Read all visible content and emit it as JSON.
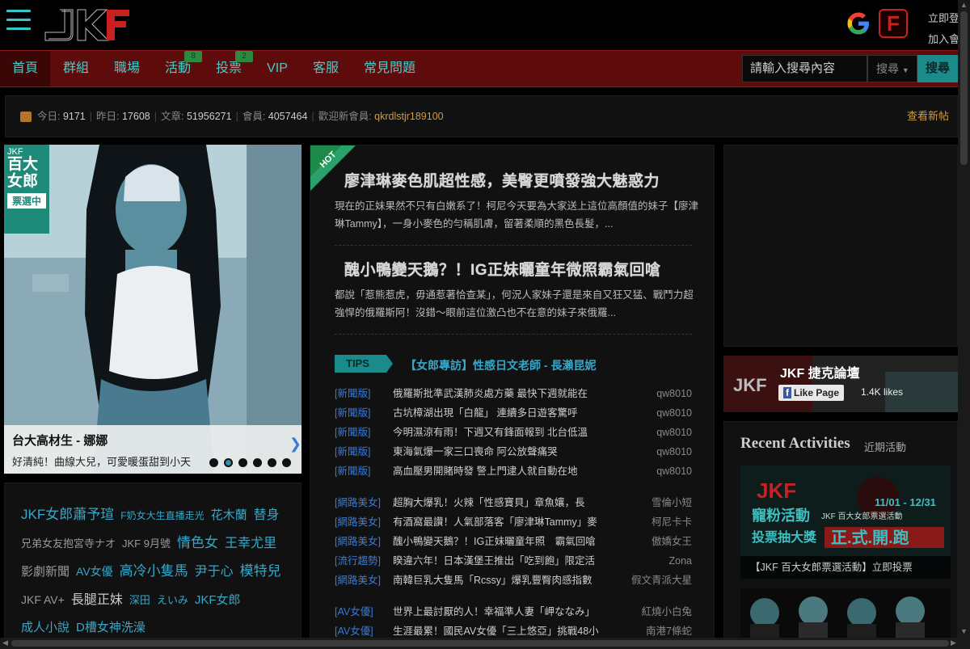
{
  "header": {
    "logo_text": "JKF",
    "right_links": [
      "立即登",
      "加入會"
    ],
    "g_icon": "google-icon",
    "f_icon": "F"
  },
  "nav": {
    "items": [
      "首頁",
      "群組",
      "職場",
      "活動",
      "投票",
      "VIP",
      "客服",
      "常見問題"
    ],
    "badges": [
      "8",
      "2"
    ]
  },
  "search": {
    "placeholder": "請輸入搜尋內容",
    "select_value": "搜尋",
    "button_label": "搜尋"
  },
  "stats": {
    "today_label": "今日: ",
    "today": "9171",
    "yesterday_label": "昨日: ",
    "yesterday": "17608",
    "posts_label": "文章: ",
    "posts": "51956271",
    "members_label": "會員: ",
    "members": "4057464",
    "welcome_label": "歡迎新會員: ",
    "new_member": "qkrdlstjr189100",
    "new_posts": "查看新帖"
  },
  "banner": {
    "badge_lines": [
      "JKF",
      "百大",
      "女郎",
      "票選中"
    ],
    "title": "台大高材生 - 娜娜",
    "subtitle": "好清純！曲線大兒，可愛暖蛋甜到小天",
    "dots": 7,
    "active_dot": 1
  },
  "tags": [
    {
      "text": "JKF女郎蕭予瑄",
      "size": 17,
      "color": "#36a7c8"
    },
    {
      "text": "F奶女大生直播走光",
      "size": 12,
      "color": "#36a7c8"
    },
    {
      "text": "花木蘭",
      "size": 15,
      "color": "#36a7c8"
    },
    {
      "text": "替身",
      "size": 16,
      "color": "#36a7c8"
    },
    {
      "text": "兄弟女友抱宮寺ナオ",
      "size": 13,
      "color": "#999"
    },
    {
      "text": "JKF 9月號",
      "size": 13,
      "color": "#999"
    },
    {
      "text": "情色女",
      "size": 17,
      "color": "#36a7c8"
    },
    {
      "text": "王幸尤里",
      "size": 16,
      "color": "#36a7c8"
    },
    {
      "text": "影劇新聞",
      "size": 15,
      "color": "#999"
    },
    {
      "text": "AV女優",
      "size": 14,
      "color": "#36a7c8"
    },
    {
      "text": "高冷小隻馬",
      "size": 17,
      "color": "#36a7c8"
    },
    {
      "text": "尹于心",
      "size": 16,
      "color": "#36a7c8"
    },
    {
      "text": "模特兒",
      "size": 17,
      "color": "#36a7c8"
    },
    {
      "text": "JKF AV+",
      "size": 14,
      "color": "#999"
    },
    {
      "text": "長腿正妹",
      "size": 16,
      "color": "#ccc"
    },
    {
      "text": "深田",
      "size": 13,
      "color": "#36a7c8"
    },
    {
      "text": "えいみ",
      "size": 13,
      "color": "#36a7c8"
    },
    {
      "text": "JKF女郎",
      "size": 15,
      "color": "#36a7c8"
    },
    {
      "text": "成人小說",
      "size": 15,
      "color": "#36a7c8"
    },
    {
      "text": "D槽女神洗澡",
      "size": 15,
      "color": "#36a7c8"
    }
  ],
  "featured": [
    {
      "title": "廖津琳麥色肌超性感，美臀更噴發強大魅惑力",
      "body": "現在的正妹果然不只有白嫩系了！柯尼今天要為大家送上這位高顏值的妹子【廖津琳Tammy】，一身小麥色的勻稱肌膚，留著柔順的黑色長髮，..."
    },
    {
      "title": "醜小鴨變天鵝？！IG正妹曬童年微照霸氣回嗆",
      "body": "都說「惹熊惹虎，毋通惹著恰查某」，何況人家妹子還是來自又狂又猛、戰鬥力超強悍的俄羅斯阿！沒錯～眼前這位激凸也不在意的妹子來俄羅..."
    }
  ],
  "hot_label": "HOT",
  "tips": {
    "label": "TIPS",
    "title": "【女郎專訪】性感日文老師 - 長瀨昆妮"
  },
  "news": [
    {
      "cat": "[新聞版]",
      "text": "俄羅斯批準武漢肺炎處方藥 最快下週就能在",
      "author": "qw8010"
    },
    {
      "cat": "[新聞版]",
      "text": "古坑樟湖出現「白龍」 連續多日遊客驚呼",
      "author": "qw8010"
    },
    {
      "cat": "[新聞版]",
      "text": "今明濕涼有雨！下週又有鋒面報到 北台低溫",
      "author": "qw8010"
    },
    {
      "cat": "[新聞版]",
      "text": "東海氣爆一家三口喪命 阿公放聲痛哭",
      "author": "qw8010"
    },
    {
      "cat": "[新聞版]",
      "text": "高血壓男開賭時發 警上門逮人就自動在地",
      "author": "qw8010"
    },
    {
      "cat": "[網路美女]",
      "text": "超胸大爆乳！火辣「性感寶貝」章魚孃，長",
      "author": "雪倫小短"
    },
    {
      "cat": "[網路美女]",
      "text": "有酒窩最讚！人氣部落客「廖津琳Tammy」麥",
      "author": "柯尼卡卡"
    },
    {
      "cat": "[網路美女]",
      "text": "醜小鴨變天鵝？！IG正妹曬童年照　霸氣回嗆",
      "author": "傲嬌女王"
    },
    {
      "cat": "[流行趨勢]",
      "text": "睽違六年！日本漢堡王推出「吃到飽」限定活",
      "author": "Zona"
    },
    {
      "cat": "[網路美女]",
      "text": "南韓巨乳大隻馬「Rcssy」爆乳豐臀肉感指數",
      "author": "假文青派大星"
    },
    {
      "cat": "[AV女優]",
      "text": "世界上最討厭的人！幸福準人妻「岬ななみ」",
      "author": "紅燒小白兔"
    },
    {
      "cat": "[AV女優]",
      "text": "生涯最累！國民AV女優「三上悠亞」挑戰48小",
      "author": "南港7條蛇"
    }
  ],
  "facebook": {
    "page_name": "JKF 捷克論壇",
    "like_label": "Like Page",
    "likes_text": "1.4K likes"
  },
  "recent": {
    "heading": "Recent Activities",
    "sub": "近期活動",
    "act1_caption": "【JKF 百大女郎票選活動】立即投票",
    "act1_dates": "11/01 - 12/31",
    "act1_title_a": "寵粉活動",
    "act1_title_b": "正.式.開.跑",
    "act1_small": "JKF 百大女郎票選活動",
    "act1_small2": "投票抽大獎",
    "act1_kicker": "JKF"
  }
}
